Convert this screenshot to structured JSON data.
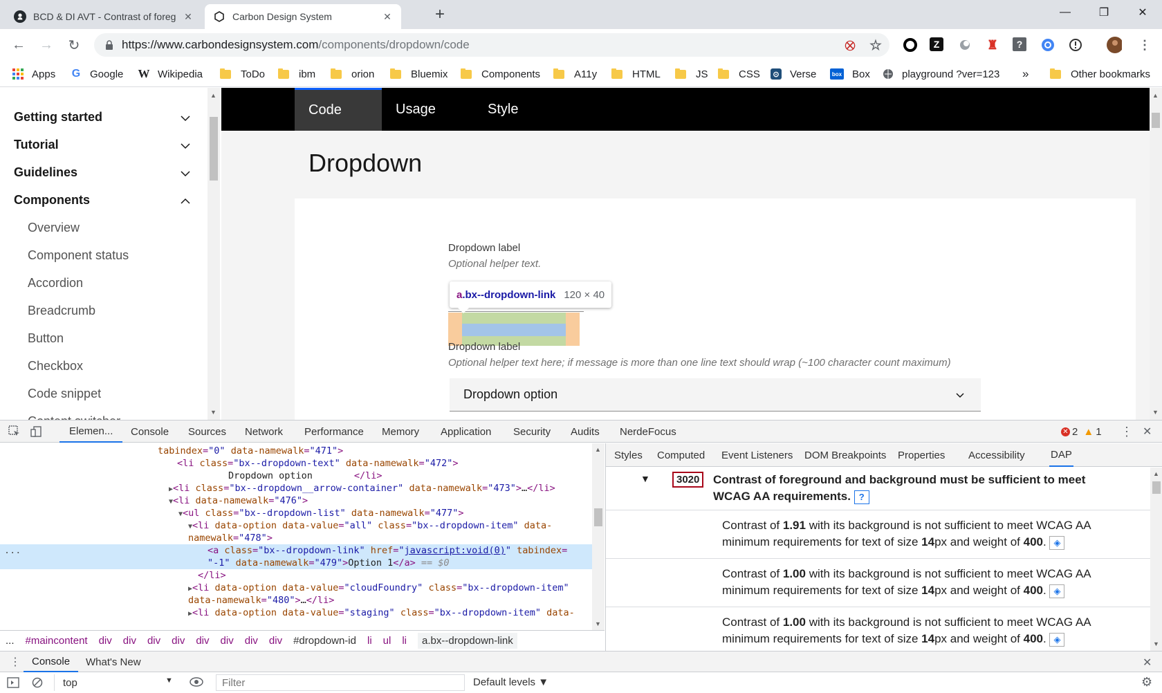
{
  "browser": {
    "tabs": [
      {
        "title": "BCD & DI AVT - Contrast of foreg",
        "active": false
      },
      {
        "title": "Carbon Design System",
        "active": true
      }
    ],
    "new_tab_glyph": "+",
    "url_host": "https://www.carbondesignsystem.com",
    "url_path": "/components/dropdown/code",
    "bookmarks": [
      {
        "label": "Apps",
        "icon": "apps-grid-icon"
      },
      {
        "label": "Google",
        "icon": "google-icon"
      },
      {
        "label": "Wikipedia",
        "icon": "wikipedia-icon"
      },
      {
        "label": "ToDo",
        "icon": "folder-icon"
      },
      {
        "label": "ibm",
        "icon": "folder-icon"
      },
      {
        "label": "orion",
        "icon": "folder-icon"
      },
      {
        "label": "Bluemix",
        "icon": "folder-icon"
      },
      {
        "label": "Components",
        "icon": "folder-icon"
      },
      {
        "label": "A11y",
        "icon": "folder-icon"
      },
      {
        "label": "HTML",
        "icon": "folder-icon"
      },
      {
        "label": "JS",
        "icon": "folder-icon"
      },
      {
        "label": "CSS",
        "icon": "folder-icon"
      },
      {
        "label": "Verse",
        "icon": "verse-icon"
      },
      {
        "label": "Box",
        "icon": "box-icon"
      },
      {
        "label": "playground ?ver=123",
        "icon": "globe-icon"
      }
    ],
    "bookmarks_overflow": "»",
    "other_bookmarks": "Other bookmarks",
    "colors": {
      "accent": "#1a73e8",
      "tabstrip": "#dee1e6"
    }
  },
  "sidebar": {
    "sections": [
      {
        "label": "Getting started",
        "expanded": false
      },
      {
        "label": "Tutorial",
        "expanded": false
      },
      {
        "label": "Guidelines",
        "expanded": false
      },
      {
        "label": "Components",
        "expanded": true
      }
    ],
    "items": [
      "Overview",
      "Component status",
      "Accordion",
      "Breadcrumb",
      "Button",
      "Checkbox",
      "Code snippet",
      "Content switcher"
    ]
  },
  "content": {
    "tabs": [
      {
        "label": "Code",
        "selected": true
      },
      {
        "label": "Usage",
        "selected": false
      },
      {
        "label": "Style",
        "selected": false
      }
    ],
    "title": "Dropdown",
    "demo": {
      "label1": "Dropdown label",
      "helper1": "Optional helper text.",
      "tooltip_tag": "a",
      "tooltip_class": ".bx--dropdown-link",
      "tooltip_size": "120 × 40",
      "label2": "Dropdown label",
      "helper2": "Optional helper text here; if message is more than one line text should wrap (~100 character count maximum)",
      "dropdown_value": "Dropdown option"
    },
    "colors": {
      "tab_bar": "#000000",
      "selected_tab": "#393939",
      "tab_indicator": "#0f62fe"
    }
  },
  "devtools": {
    "tabs": [
      "Elemen...",
      "Console",
      "Sources",
      "Network",
      "Performance",
      "Memory",
      "Application",
      "Security",
      "Audits",
      "NerdeFocus"
    ],
    "selected_tab": "Elemen...",
    "errors": "2",
    "warnings": "1",
    "elements": {
      "selected_marker": "== $0",
      "dots": "...",
      "text_dropdown_option": "Dropdown option",
      "text_option1": "Option 1",
      "href_value": "javascript:void(0)"
    },
    "breadcrumbs": [
      "#maincontent",
      "div",
      "div",
      "div",
      "div",
      "div",
      "div",
      "div",
      "div",
      "#dropdown-id",
      "li",
      "ul",
      "li",
      "a.bx--dropdown-link"
    ],
    "breadcrumb_ellipsis": "...",
    "side_tabs": [
      "Styles",
      "Computed",
      "Event Listeners",
      "DOM Breakpoints",
      "Properties",
      "Accessibility",
      "DAP"
    ],
    "side_selected": "DAP",
    "dap": {
      "rule_count": "3020",
      "rule_title": "Contrast of foreground and background must be sufficient to meet WCAG AA requirements.",
      "help_glyph": "?",
      "issues": [
        {
          "contrast": "1.91",
          "size": "14",
          "weight": "400"
        },
        {
          "contrast": "1.00",
          "size": "14",
          "weight": "400"
        },
        {
          "contrast": "1.00",
          "size": "14",
          "weight": "400"
        }
      ],
      "issue_prefix": "Contrast of ",
      "issue_mid": " with its background is not sufficient to meet WCAG AA minimum requirements for text of size ",
      "issue_px": "px and weight of ",
      "issue_end": "."
    },
    "drawer_tabs": [
      "Console",
      "What's New"
    ],
    "console_context": "top",
    "filter_placeholder": "Filter",
    "levels": "Default levels ▼"
  }
}
